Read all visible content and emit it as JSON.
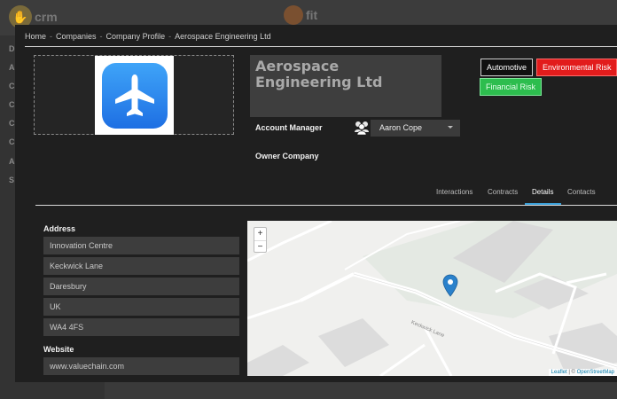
{
  "background_app": {
    "logo_left_text": "crm",
    "logo_right_text": "fit",
    "sidebar_letters": [
      "D",
      "A",
      "C",
      "C",
      "C",
      "C",
      "A",
      "S"
    ]
  },
  "breadcrumb": [
    "Home",
    "Companies",
    "Company Profile",
    "Aerospace Engineering Ltd"
  ],
  "breadcrumb_separator": "-",
  "company": {
    "name": "Aerospace Engineering Ltd",
    "logo_icon": "airplane-app-icon"
  },
  "tags": [
    {
      "label": "Automotive",
      "color": "#111111"
    },
    {
      "label": "Environmental Risk",
      "color": "#e21c1c"
    },
    {
      "label": "Financial Risk",
      "color": "#2dbd4e"
    }
  ],
  "fields": {
    "account_manager_label": "Account Manager",
    "account_manager_value": "Aaron Cope",
    "owner_company_label": "Owner Company"
  },
  "tabs": [
    {
      "label": "Interactions",
      "active": false
    },
    {
      "label": "Contracts",
      "active": false
    },
    {
      "label": "Details",
      "active": true
    },
    {
      "label": "Contacts",
      "active": false
    }
  ],
  "details": {
    "address_label": "Address",
    "address_lines": [
      "Innovation Centre",
      "Keckwick Lane",
      "Daresbury",
      "UK",
      "WA4 4FS"
    ],
    "website_label": "Website",
    "website": "www.valuechain.com"
  },
  "map": {
    "zoom_in": "+",
    "zoom_out": "−",
    "road_label": "Keckwick Lane",
    "attribution_leaflet": "Leaflet",
    "attribution_sep": " | © ",
    "attribution_osm": "OpenStreetMap"
  },
  "colors": {
    "accent": "#3a9fd8",
    "marker": "#2a81cb"
  }
}
